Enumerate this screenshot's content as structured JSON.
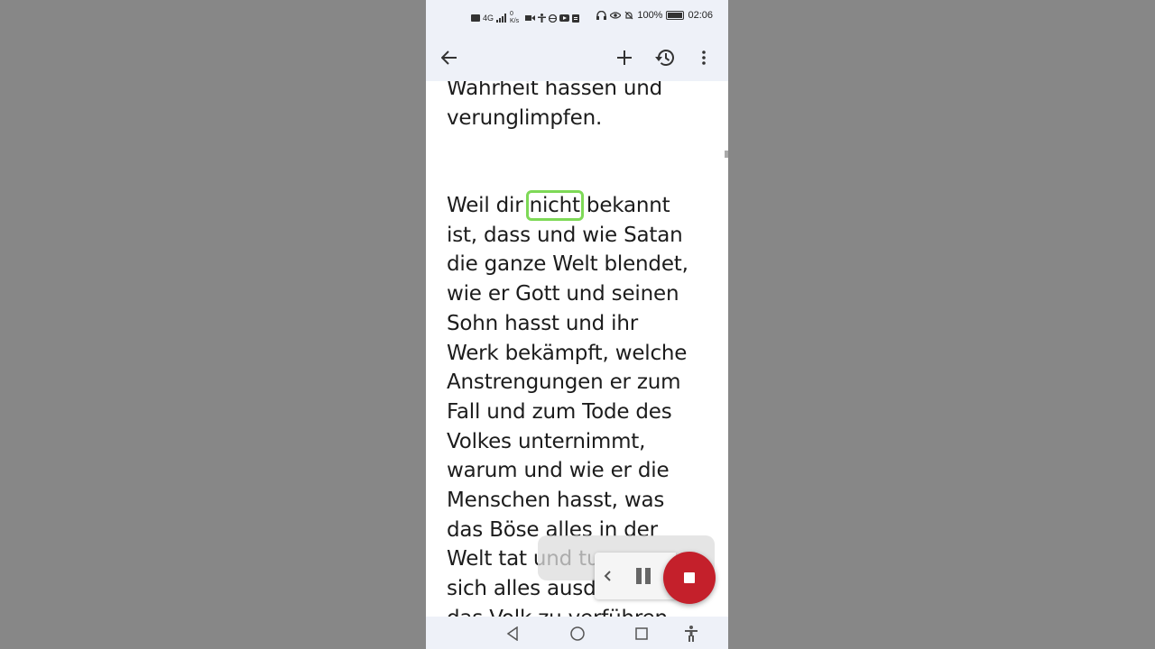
{
  "status_bar": {
    "net_speed": "0 K/s",
    "signal_label": "4G",
    "battery": "100%",
    "time": "02:06"
  },
  "toolbar": {
    "icons": [
      "back-arrow-icon",
      "add-icon",
      "history-icon",
      "more-vert-icon"
    ]
  },
  "document": {
    "para1_lines": [
      "Wahrheit hassen und",
      "verunglimpfen."
    ],
    "para2": {
      "line1_before": "Weil dir ",
      "highlight_word": "nicht",
      "line1_after": " bekannt",
      "lines": [
        "ist, dass und wie Satan",
        "die ganze Welt blendet,",
        "wie er Gott und seinen",
        "Sohn hasst und ihr",
        "Werk bekämpft, welche",
        "Anstrengungen er zum",
        "Fall und zum Tode des",
        "Volkes unternimmt,",
        "warum und wie er die",
        "Menschen hasst, was",
        "das Böse alles in der",
        "Welt tat und tu",
        "sich alles ausd",
        "das Volk zu verführen"
      ]
    },
    "highlight_color": "#7ed957"
  },
  "recorder": {
    "stop_color": "#c4202b"
  },
  "nav_bar": {
    "icons": [
      "nav-back-icon",
      "nav-home-icon",
      "nav-recents-icon",
      "accessibility-icon"
    ]
  }
}
